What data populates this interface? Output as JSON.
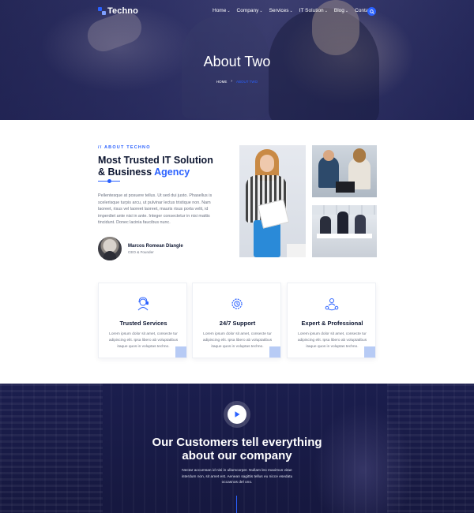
{
  "header": {
    "logo_text": "Techno",
    "menu": [
      {
        "label": "Home",
        "has_dropdown": true
      },
      {
        "label": "Company",
        "has_dropdown": true
      },
      {
        "label": "Services",
        "has_dropdown": true
      },
      {
        "label": "IT Solution",
        "has_dropdown": true
      },
      {
        "label": "Blog",
        "has_dropdown": true
      },
      {
        "label": "Contact",
        "has_dropdown": true
      }
    ],
    "search_icon": "search-icon"
  },
  "hero": {
    "title": "About Two",
    "breadcrumb": {
      "home": "HOME",
      "current": "ABOUT TWO"
    }
  },
  "about": {
    "tag": "// ABOUT TECHNO",
    "title_line1": "Most Trusted IT Solution",
    "title_line2_prefix": "& Business",
    "title_accent": "Agency",
    "text": "Pellentesque at posuere tellus. Ut sed dui justo. Phasellus is scelerisque turpis arcu, ut pulvinar lectus tristique non. Nam laoreet, risus vel laoreet laoreet, mauris risus porta velit, id imperdiet ante nisi in ante. Integer consectetur in nisi mattis tincidunt. Donec lacinia faucibus nunc.",
    "author": {
      "name": "Marcos Romean Dlangle",
      "role": "CEO & Founder"
    }
  },
  "features": [
    {
      "icon": "support-agent-icon",
      "title": "Trusted Services",
      "text": "Lorem ipsum dolor sit amet, consecte tur adipiscing elit. Ipsa libero ab voluptatibus itaque quos in voluptas techno."
    },
    {
      "icon": "gear-hours-icon",
      "title": "24/7 Support",
      "text": "Lorem ipsum dolor sit amet, consecte tur adipiscing elit. Ipsa libero ab voluptatibus itaque quos in voluptas techno."
    },
    {
      "icon": "team-network-icon",
      "title": "Expert & Professional",
      "text": "Lorem ipsum dolor sit amet, consecte tur adipiscing elit. Ipsa libero ab voluptatibus itaque quos in voluptas techno."
    }
  ],
  "testimonial": {
    "play_icon": "play-icon",
    "title_line1": "Our Customers tell everything",
    "title_line2": "about our company",
    "text": "Nectar accumsan id nisi in ullamcorper. Nullam leo maximus vitae interdum non, sit amet est. Aenean sagittis tellus eu nicce esedatu occasnos del ono."
  },
  "colors": {
    "accent": "#2a61ff",
    "dark": "#0d1631",
    "testimonial_bg": "#1b1e4e"
  }
}
